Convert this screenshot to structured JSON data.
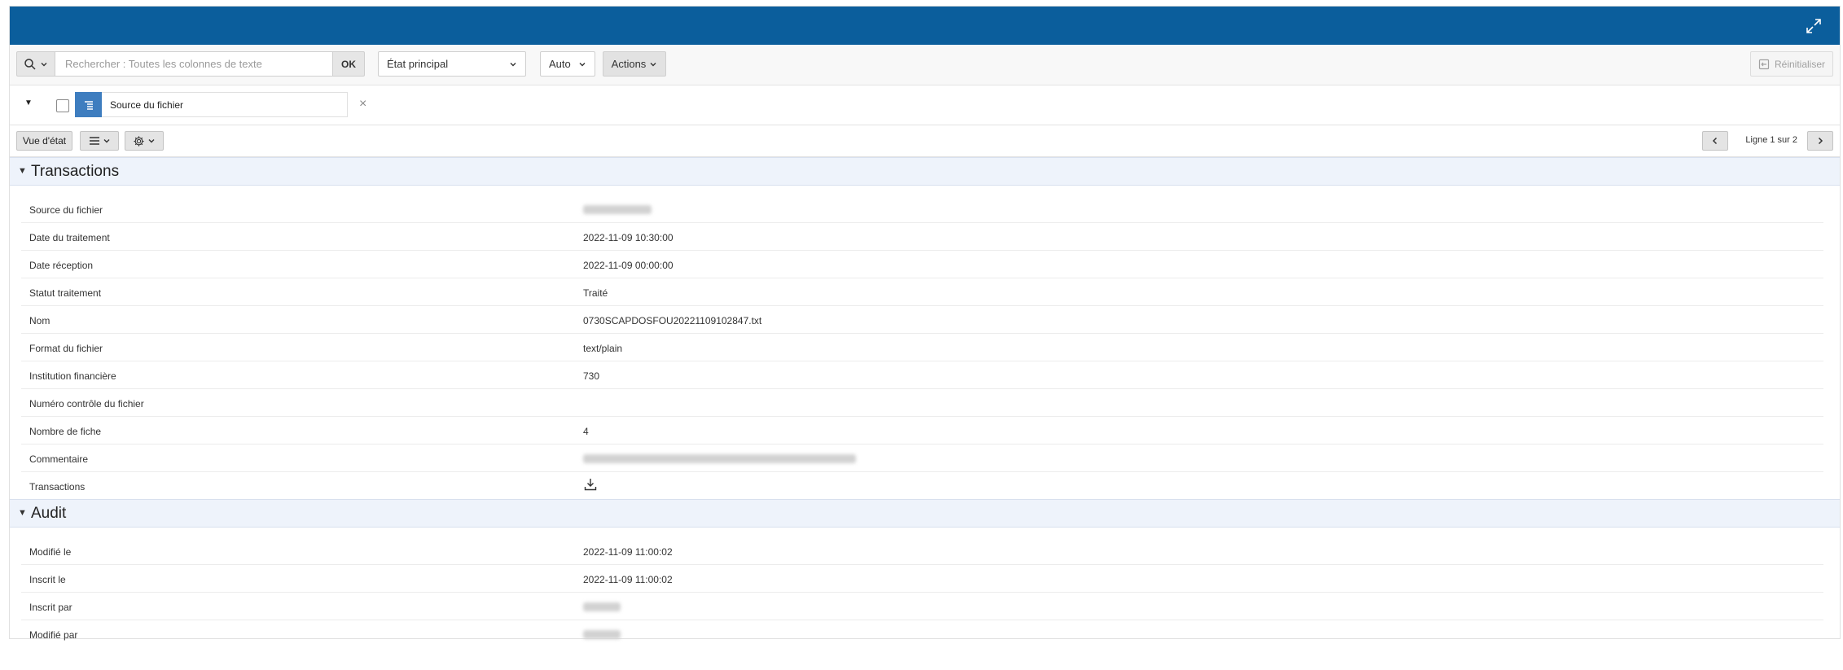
{
  "toolbar": {
    "search_placeholder": "Rechercher : Toutes les colonnes de texte",
    "ok_label": "OK",
    "report_select": "État principal",
    "rows_select": "Auto",
    "actions_label": "Actions",
    "reset_label": "Réinitialiser"
  },
  "filter": {
    "label": "Source du fichier",
    "close": "×"
  },
  "viewbar": {
    "vue_label": "Vue d'état",
    "pagination": "Ligne 1 sur 2"
  },
  "sections": {
    "transactions": {
      "title": "Transactions",
      "rows": [
        {
          "label": "Source du fichier",
          "value": ""
        },
        {
          "label": "Date du traitement",
          "value": "2022-11-09 10:30:00"
        },
        {
          "label": "Date réception",
          "value": "2022-11-09 00:00:00"
        },
        {
          "label": "Statut traitement",
          "value": "Traité"
        },
        {
          "label": "Nom",
          "value": "0730SCAPDOSFOU20221109102847.txt"
        },
        {
          "label": "Format du fichier",
          "value": "text/plain"
        },
        {
          "label": "Institution financière",
          "value": "730"
        },
        {
          "label": "Numéro contrôle du fichier",
          "value": ""
        },
        {
          "label": "Nombre de fiche",
          "value": "4"
        },
        {
          "label": "Commentaire",
          "value": ""
        },
        {
          "label": "Transactions",
          "value": ""
        }
      ]
    },
    "audit": {
      "title": "Audit",
      "rows": [
        {
          "label": "Modifié le",
          "value": "2022-11-09 11:00:02"
        },
        {
          "label": "Inscrit le",
          "value": "2022-11-09 11:00:02"
        },
        {
          "label": "Inscrit par",
          "value": ""
        },
        {
          "label": "Modifié par",
          "value": ""
        }
      ]
    }
  },
  "colors": {
    "header": "#0b5e9c",
    "filter_icon": "#3e7dbf",
    "section_bg": "#eef3fb"
  },
  "icons": {
    "expand": "expand-icon",
    "search": "search-icon",
    "download": "download-icon",
    "gear": "gear-icon",
    "list": "list-icon"
  }
}
